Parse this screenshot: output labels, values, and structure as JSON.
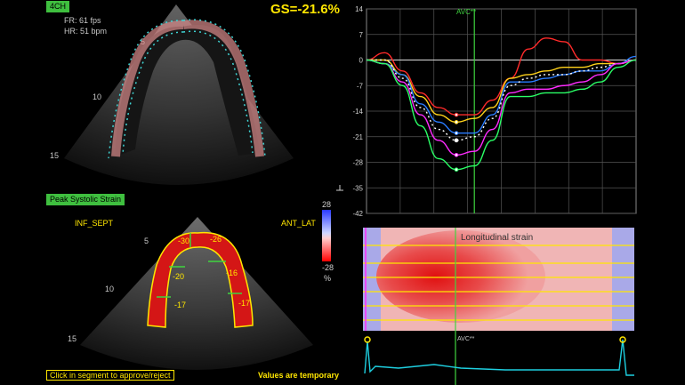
{
  "view_tag": "4CH",
  "frame_rate": "FR: 61 fps",
  "heart_rate": "HR: 51 bpm",
  "global_strain": "GS=-21.6%",
  "depth_top": [
    "5",
    "10",
    "15"
  ],
  "depth_bottom": [
    "5",
    "10",
    "15"
  ],
  "peak_tag": "Peak Systolic Strain",
  "inf_sept": "INF_SEPT",
  "ant_lat": "ANT_LAT",
  "segment_values": [
    "-30",
    "-26",
    "-20",
    "-16",
    "-17",
    "-17"
  ],
  "colorbar": {
    "max": "28",
    "min": "-28",
    "unit": "%"
  },
  "hint_left": "Click in segment to approve/reject",
  "hint_right": "Values are temporary",
  "avc_label": "AVC**",
  "avc_label_bottom": "AVC**",
  "map_title": "Longitudinal strain",
  "colors": {
    "accent": "#3fbf3f",
    "yellow": "#ffe600"
  },
  "chart_data": {
    "type": "line",
    "yticks": [
      "14",
      "7",
      "0",
      "-7",
      "-14",
      "-21",
      "-28",
      "-35",
      "-42"
    ],
    "ylim": [
      -42,
      14
    ],
    "series": [
      {
        "color": "#ff2a2a",
        "values": [
          0,
          2,
          -3,
          -9,
          -13,
          -15,
          -15,
          -11,
          -5,
          3,
          6,
          5,
          0,
          0,
          -1,
          0
        ]
      },
      {
        "color": "#ffd21a",
        "values": [
          0,
          0,
          -4,
          -10,
          -15,
          -17,
          -16,
          -13,
          -5,
          -4,
          -3,
          -2,
          -2,
          -1,
          -1,
          0
        ]
      },
      {
        "color": "#2a7cff",
        "values": [
          0,
          -1,
          -4,
          -12,
          -17,
          -20,
          -20,
          -15,
          -6,
          -6,
          -5,
          -4,
          -3,
          -3,
          -1,
          1
        ]
      },
      {
        "color": "#ffffff",
        "values": [
          0,
          0,
          -5,
          -13,
          -19,
          -22,
          -21,
          -16,
          -7,
          -5,
          -4,
          -4,
          -3,
          -2,
          -1,
          0
        ]
      },
      {
        "color": "#ff2aff",
        "values": [
          0,
          -1,
          -6,
          -15,
          -22,
          -26,
          -25,
          -19,
          -9,
          -8,
          -8,
          -7,
          -6,
          -4,
          -1,
          0
        ]
      },
      {
        "color": "#2aff66",
        "values": [
          0,
          -1,
          -7,
          -18,
          -27,
          -30,
          -29,
          -22,
          -10,
          -10,
          -9,
          -9,
          -8,
          -6,
          -2,
          0
        ]
      }
    ]
  }
}
